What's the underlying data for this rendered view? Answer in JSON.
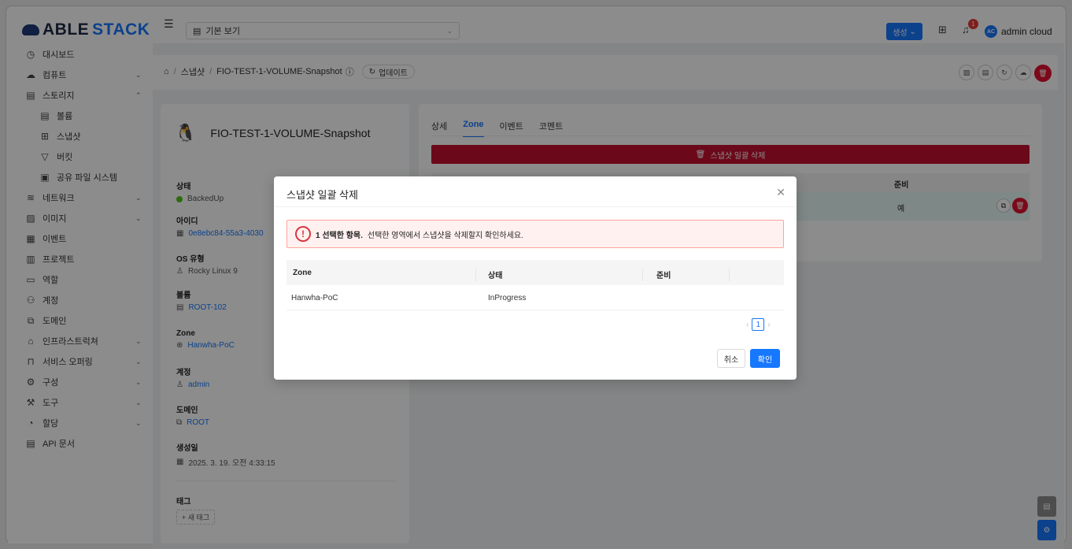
{
  "brand": {
    "prefix": "ABLE",
    "suffix": "STACK"
  },
  "sidebar": {
    "items": [
      {
        "label": "대시보드",
        "icon": "dashboard-icon"
      },
      {
        "label": "컴퓨트",
        "icon": "cloud-icon"
      },
      {
        "label": "스토리지",
        "icon": "storage-icon"
      },
      {
        "label": "볼륨",
        "icon": "volume-icon"
      },
      {
        "label": "스냅샷",
        "icon": "snapshot-icon"
      },
      {
        "label": "버킷",
        "icon": "bucket-icon"
      },
      {
        "label": "공유 파일 시스템",
        "icon": "file-system-icon"
      },
      {
        "label": "네트워크",
        "icon": "wifi-icon"
      },
      {
        "label": "이미지",
        "icon": "image-icon"
      },
      {
        "label": "이벤트",
        "icon": "calendar-icon"
      },
      {
        "label": "프로젝트",
        "icon": "project-icon"
      },
      {
        "label": "역할",
        "icon": "role-icon"
      },
      {
        "label": "계정",
        "icon": "users-icon"
      },
      {
        "label": "도메인",
        "icon": "domain-icon"
      },
      {
        "label": "인프라스트럭쳐",
        "icon": "bank-icon"
      },
      {
        "label": "서비스 오퍼링",
        "icon": "shopping-icon"
      },
      {
        "label": "구성",
        "icon": "gear-icon"
      },
      {
        "label": "도구",
        "icon": "tool-icon"
      },
      {
        "label": "할당",
        "icon": "pie-chart-icon"
      },
      {
        "label": "API 문서",
        "icon": "book-icon"
      }
    ]
  },
  "topbar": {
    "view_select": "기본 보기",
    "create_label": "생성",
    "notification_count": "1",
    "avatar_initials": "AC",
    "username": "admin cloud"
  },
  "breadcrumb": {
    "section": "스냅샷",
    "current": "FIO-TEST-1-VOLUME-Snapshot",
    "refresh_label": "업데이트"
  },
  "info": {
    "name": "FIO-TEST-1-VOLUME-Snapshot",
    "status_label": "상태",
    "status_value": "BackedUp",
    "id_label": "아이디",
    "id_value": "0e8ebc84-55a3-4030",
    "os_label": "OS 유형",
    "os_value": "Rocky Linux 9",
    "volume_label": "볼륨",
    "volume_value": "ROOT-102",
    "zone_label": "Zone",
    "zone_value": "Hanwha-PoC",
    "account_label": "계정",
    "account_value": "admin",
    "domain_label": "도메인",
    "domain_value": "ROOT",
    "created_label": "생성일",
    "created_value": "2025. 3. 19. 오전 4:33:15",
    "tags_label": "태그",
    "new_tag": "+ 새 태그"
  },
  "tabs": [
    "상세",
    "Zone",
    "이벤트",
    "코멘트"
  ],
  "zone_panel": {
    "bulk_delete_label": "스냅샷 일괄 삭제",
    "ready_header": "준비",
    "ready_value": "예"
  },
  "modal": {
    "title": "스냅샷 일괄 삭제",
    "alert_bold": "1 선택한 항목.",
    "alert_text": "선택한 영역에서 스냅샷을 삭제할지 확인하세요.",
    "columns": [
      "Zone",
      "상태",
      "준비"
    ],
    "rows": [
      {
        "zone": "Hanwha-PoC",
        "status": "InProgress",
        "ready": ""
      }
    ],
    "page": "1",
    "cancel_label": "취소",
    "ok_label": "확인"
  },
  "colors": {
    "primary": "#1677ff",
    "danger": "#e0112e",
    "success": "#52c41a"
  }
}
